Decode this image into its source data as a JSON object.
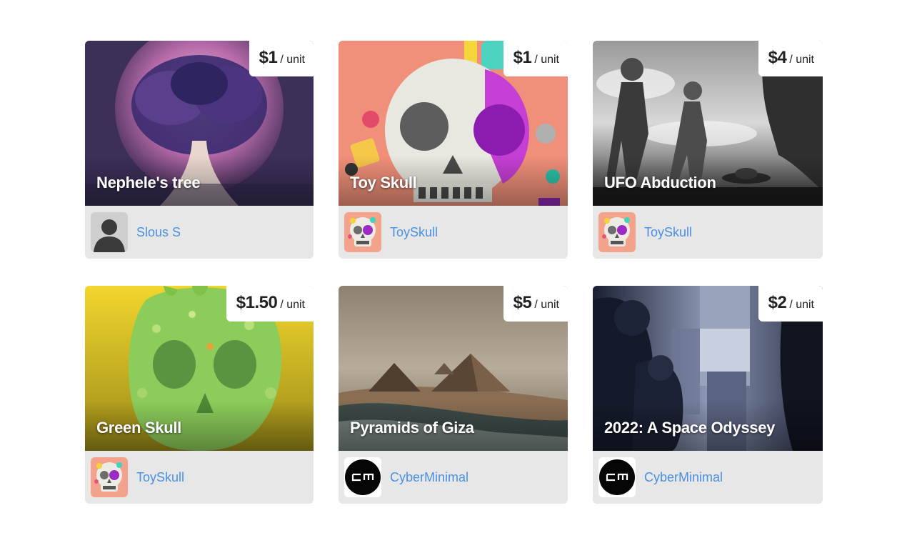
{
  "listings": [
    {
      "title": "Nephele's tree",
      "price": "$1",
      "unit": "/ unit",
      "author": "Slous S",
      "avatar_icon": "default-user-avatar",
      "art": "purple-tree-planet"
    },
    {
      "title": "Toy Skull",
      "price": "$1",
      "unit": "/ unit",
      "author": "ToySkull",
      "avatar_icon": "toy-skull-avatar",
      "art": "toy-skull"
    },
    {
      "title": "UFO Abduction",
      "price": "$4",
      "unit": "/ unit",
      "author": "ToySkull",
      "avatar_icon": "toy-skull-avatar",
      "art": "ufo-abduction-bw"
    },
    {
      "title": "Green Skull",
      "price": "$1.50",
      "unit": "/ unit",
      "author": "ToySkull",
      "avatar_icon": "toy-skull-avatar",
      "art": "green-slime-skull"
    },
    {
      "title": "Pyramids of Giza",
      "price": "$5",
      "unit": "/ unit",
      "author": "CyberMinimal",
      "avatar_icon": "cyberminimal-logo-avatar",
      "art": "pyramids-coast"
    },
    {
      "title": "2022: A Space Odyssey",
      "price": "$2",
      "unit": "/ unit",
      "author": "CyberMinimal",
      "avatar_icon": "cyberminimal-logo-avatar",
      "art": "apes-monolith"
    }
  ],
  "colors": {
    "link": "#4a90e2",
    "card_bg": "#e7e7e7",
    "price_bg": "#ffffff"
  }
}
